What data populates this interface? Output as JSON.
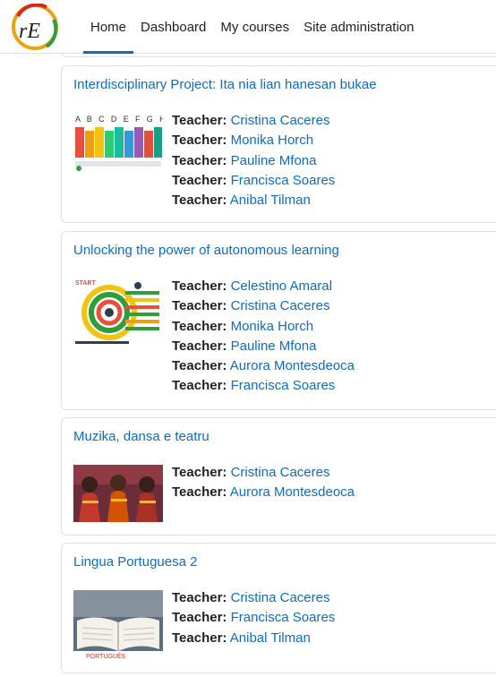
{
  "logo": {
    "letters": "rE"
  },
  "nav": {
    "items": [
      {
        "label": "Home",
        "active": true
      },
      {
        "label": "Dashboard",
        "active": false
      },
      {
        "label": "My courses",
        "active": false
      },
      {
        "label": "Site administration",
        "active": false
      }
    ]
  },
  "courses": [
    {
      "title": "Interdisciplinary Project: Ita nia lian hanesan bukae",
      "teachers": [
        {
          "label": "Teacher:",
          "name": "Cristina Caceres"
        },
        {
          "label": "Teacher:",
          "name": "Monika Horch"
        },
        {
          "label": "Teacher:",
          "name": "Pauline Mfona"
        },
        {
          "label": "Teacher:",
          "name": "Francisca Soares"
        },
        {
          "label": "Teacher:",
          "name": "Anibal Tilman"
        }
      ]
    },
    {
      "title": "Unlocking the power of autonomous learning",
      "teachers": [
        {
          "label": "Teacher:",
          "name": "Celestino Amaral"
        },
        {
          "label": "Teacher:",
          "name": "Cristina Caceres"
        },
        {
          "label": "Teacher:",
          "name": "Monika Horch"
        },
        {
          "label": "Teacher:",
          "name": "Pauline Mfona"
        },
        {
          "label": "Teacher:",
          "name": "Aurora Montesdeoca"
        },
        {
          "label": "Teacher:",
          "name": "Francisca Soares"
        }
      ]
    },
    {
      "title": "Muzika, dansa e teatru",
      "teachers": [
        {
          "label": "Teacher:",
          "name": "Cristina Caceres"
        },
        {
          "label": "Teacher:",
          "name": "Aurora Montesdeoca"
        }
      ]
    },
    {
      "title": "Lingua Portuguesa 2",
      "teachers": [
        {
          "label": "Teacher:",
          "name": "Cristina Caceres"
        },
        {
          "label": "Teacher:",
          "name": "Francisca Soares"
        },
        {
          "label": "Teacher:",
          "name": "Anibal Tilman"
        }
      ]
    }
  ],
  "thumbnails": [
    {
      "icon": "alphabet-chart-icon",
      "letters": "A B C D E F G H I"
    },
    {
      "icon": "autonomous-learning-chart-icon",
      "caption": "START"
    },
    {
      "icon": "dancers-photo-icon"
    },
    {
      "icon": "open-book-photo-icon",
      "caption": "PORTUGUÊS"
    }
  ],
  "colors": {
    "link": "#0f6cbf",
    "text": "#1d2125",
    "border": "#dee2e6"
  }
}
